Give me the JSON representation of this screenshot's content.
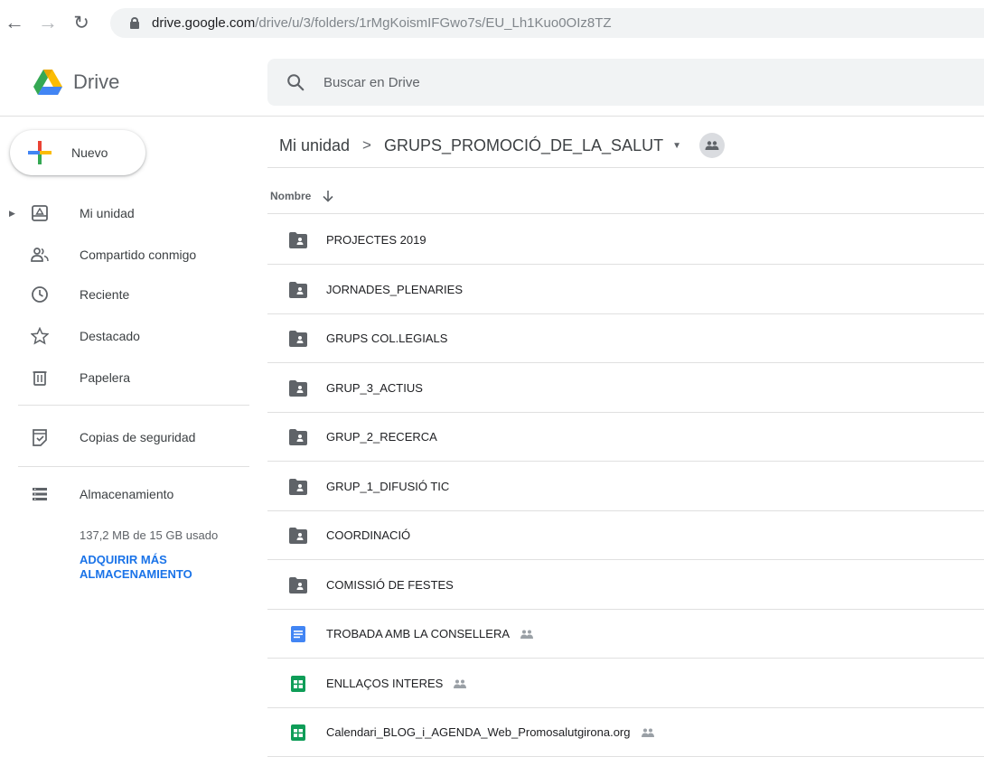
{
  "browser": {
    "url_host": "drive.google.com",
    "url_path": "/drive/u/3/folders/1rMgKoismIFGwo7s/EU_Lh1Kuo0OIz8TZ"
  },
  "app": {
    "title": "Drive",
    "search_placeholder": "Buscar en Drive"
  },
  "sidebar": {
    "new_label": "Nuevo",
    "items": [
      {
        "label": "Mi unidad",
        "icon": "my-drive-icon"
      },
      {
        "label": "Compartido conmigo",
        "icon": "shared-with-me-icon"
      },
      {
        "label": "Reciente",
        "icon": "clock-icon"
      },
      {
        "label": "Destacado",
        "icon": "star-icon"
      },
      {
        "label": "Papelera",
        "icon": "trash-icon"
      },
      {
        "label": "Copias de seguridad",
        "icon": "backup-icon"
      },
      {
        "label": "Almacenamiento",
        "icon": "storage-icon"
      }
    ],
    "storage_usage": "137,2 MB de 15 GB usado",
    "storage_link": "ADQUIRIR MÁS ALMACENAMIENTO"
  },
  "breadcrumb": {
    "root": "Mi unidad",
    "separator": ">",
    "current": "GRUPS_PROMOCIÓ_DE_LA_SALUT"
  },
  "list": {
    "name_header": "Nombre",
    "files": [
      {
        "name": "PROJECTES 2019",
        "type": "shared-folder",
        "shared": false
      },
      {
        "name": "JORNADES_PLENARIES",
        "type": "shared-folder",
        "shared": false
      },
      {
        "name": "GRUPS COL.LEGIALS",
        "type": "shared-folder",
        "shared": false
      },
      {
        "name": "GRUP_3_ACTIUS",
        "type": "shared-folder",
        "shared": false
      },
      {
        "name": "GRUP_2_RECERCA",
        "type": "shared-folder",
        "shared": false
      },
      {
        "name": "GRUP_1_DIFUSIÓ TIC",
        "type": "shared-folder",
        "shared": false
      },
      {
        "name": "COORDINACIÓ",
        "type": "shared-folder",
        "shared": false
      },
      {
        "name": "COMISSIÓ DE FESTES",
        "type": "shared-folder",
        "shared": false
      },
      {
        "name": "TROBADA AMB LA CONSELLERA",
        "type": "docs",
        "shared": true
      },
      {
        "name": "ENLLAÇOS INTERES",
        "type": "sheets",
        "shared": true
      },
      {
        "name": "Calendari_BLOG_i_AGENDA_Web_Promosalutgirona.org",
        "type": "sheets",
        "shared": true
      }
    ]
  },
  "colors": {
    "folder": "#5f6368",
    "docs": "#4285f4",
    "sheets": "#0f9d58",
    "link": "#1a73e8"
  }
}
